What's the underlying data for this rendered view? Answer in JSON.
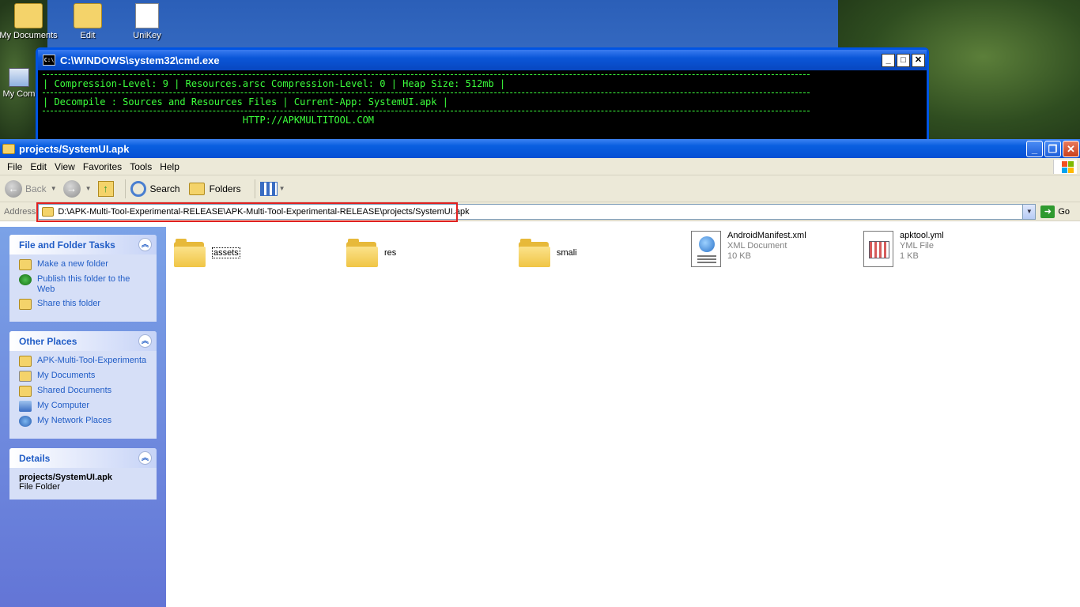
{
  "desktop": {
    "icons": [
      {
        "label": "My Documents",
        "icon": "my-documents-icon"
      },
      {
        "label": "Edit",
        "icon": "folder-icon"
      },
      {
        "label": "UniKey",
        "icon": "unikey-icon"
      },
      {
        "label": "My Com",
        "icon": "my-computer-icon"
      }
    ]
  },
  "cmd": {
    "title": "C:\\WINDOWS\\system32\\cmd.exe",
    "lines": [
      "| Compression-Level: 9 | Resources.arsc Compression-Level: 0 | Heap Size: 512mb |",
      "| Decompile : Sources and Resources Files | Current-App: SystemUI.apk |",
      "                                   HTTP://APKMULTITOOL.COM"
    ],
    "text_color": "#3cff3c"
  },
  "explorer": {
    "title": "projects/SystemUI.apk",
    "menu": [
      "File",
      "Edit",
      "View",
      "Favorites",
      "Tools",
      "Help"
    ],
    "toolbar": {
      "back": "Back",
      "search": "Search",
      "folders": "Folders"
    },
    "address": {
      "label": "Address",
      "value": "D:\\APK-Multi-Tool-Experimental-RELEASE\\APK-Multi-Tool-Experimental-RELEASE\\projects/SystemUI.apk",
      "go": "Go"
    },
    "panels": {
      "tasks": {
        "title": "File and Folder Tasks",
        "items": [
          "Make a new folder",
          "Publish this folder to the Web",
          "Share this folder"
        ]
      },
      "places": {
        "title": "Other Places",
        "items": [
          "APK-Multi-Tool-Experimenta",
          "My Documents",
          "Shared Documents",
          "My Computer",
          "My Network Places"
        ]
      },
      "details": {
        "title": "Details",
        "name": "projects/SystemUI.apk",
        "type": "File Folder"
      }
    },
    "files": [
      {
        "name": "assets",
        "kind": "folder"
      },
      {
        "name": "res",
        "kind": "folder"
      },
      {
        "name": "smali",
        "kind": "folder"
      },
      {
        "name": "AndroidManifest.xml",
        "type": "XML Document",
        "size": "10 KB"
      },
      {
        "name": "apktool.yml",
        "type": "YML File",
        "size": "1 KB"
      }
    ]
  }
}
